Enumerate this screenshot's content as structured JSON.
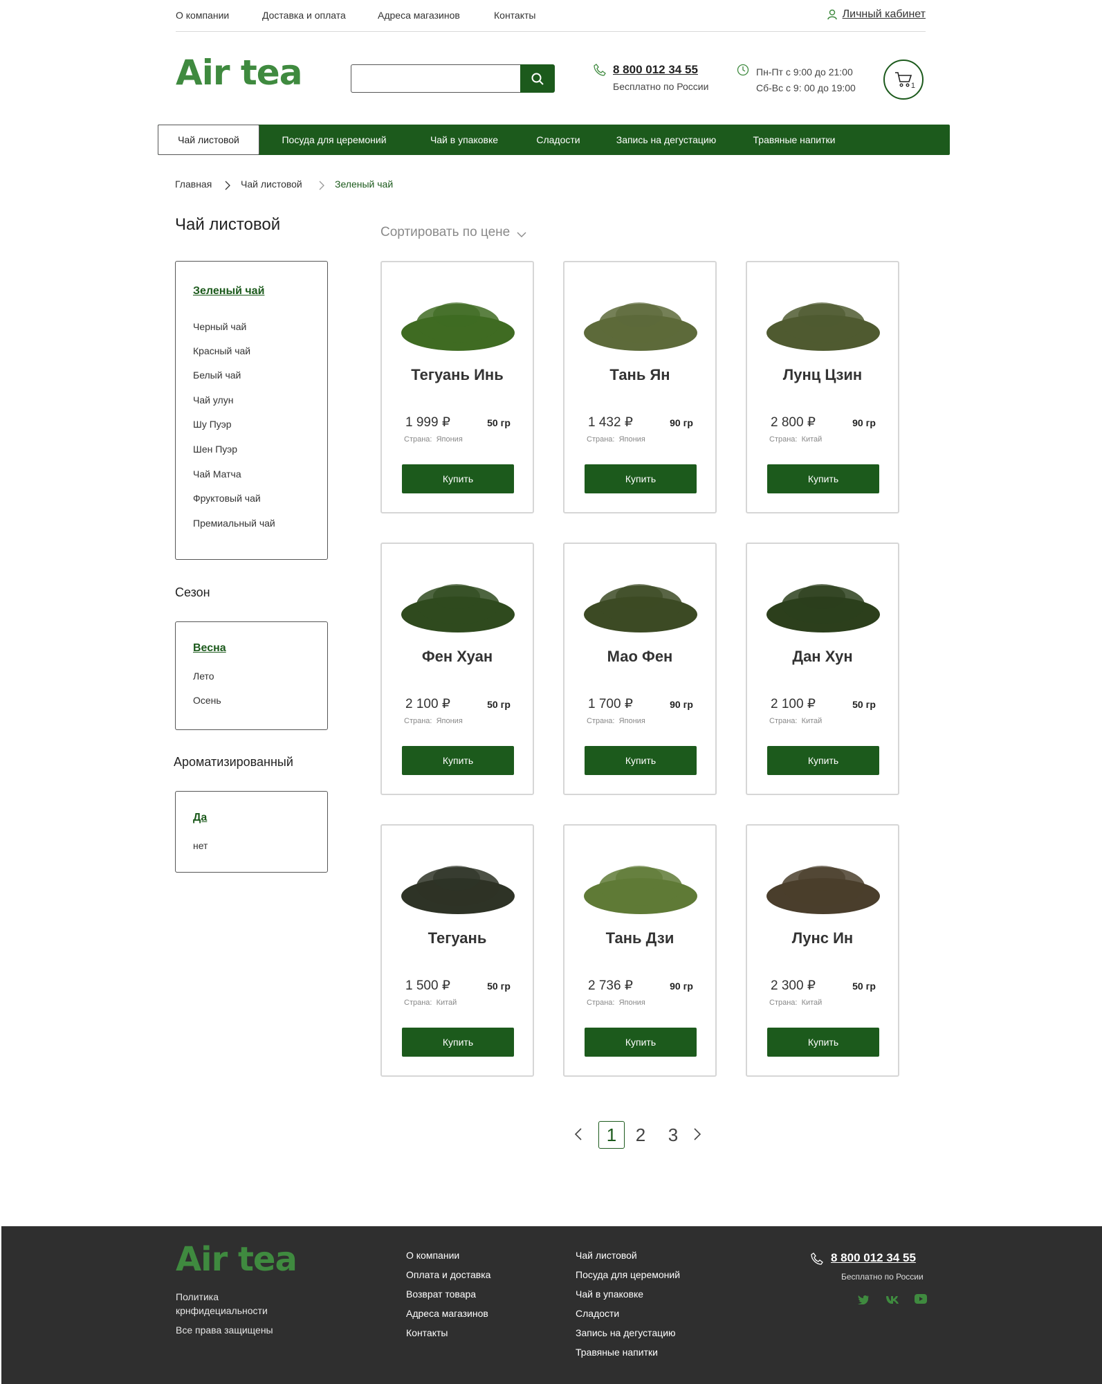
{
  "topbar": {
    "links": [
      "О компании",
      "Доставка и оплата",
      "Адреса магазинов",
      "Контакты"
    ],
    "cabinet": "Личный кабинет"
  },
  "header": {
    "logo": "Air tea",
    "search_placeholder": "",
    "phone": "8 800 012 34 55",
    "phone_note": "Бесплатно по России",
    "hours_weekday": "Пн-Пт с 9:00 до 21:00",
    "hours_weekend": "Сб-Вс с 9: 00 до 19:00",
    "cart_count": "1"
  },
  "nav": {
    "items": [
      "Чай листовой",
      "Посуда для церемоний",
      "Чай в упаковке",
      "Сладости",
      "Запись на дегустацию",
      "Травяные напитки"
    ]
  },
  "breadcrumb": [
    "Главная",
    "Чай листовой",
    "Зеленый чай"
  ],
  "sidebar": {
    "title": "Чай листовой",
    "categories": [
      "Зеленый чай",
      "Черный чай",
      "Красный чай",
      "Белый чай",
      "Чай улун",
      "Шу Пуэр",
      "Шен Пуэр",
      "Чай Матча",
      "Фруктовый чай",
      "Премиальный чай"
    ],
    "season_title": "Сезон",
    "seasons": [
      "Весна",
      "Лето",
      "Осень"
    ],
    "flavored_title": "Ароматизированный",
    "flavored": [
      "Да",
      "нет"
    ]
  },
  "sort_label": "Сортировать по цене",
  "country_label": "Страна:",
  "buy_label": "Купить",
  "products": [
    {
      "name": "Тегуань Инь",
      "price": "1 999 ₽",
      "weight": "50 гр",
      "country": "Япония",
      "color": "#3f6b22"
    },
    {
      "name": "Тань Ян",
      "price": "1 432 ₽",
      "weight": "90 гр",
      "country": "Япония",
      "color": "#5d6a3a"
    },
    {
      "name": "Лунц Цзин",
      "price": "2 800 ₽",
      "weight": "90 гр",
      "country": "Китай",
      "color": "#4f5a30"
    },
    {
      "name": "Фен Хуан",
      "price": "2 100 ₽",
      "weight": "50 гр",
      "country": "Япония",
      "color": "#2f4a1e"
    },
    {
      "name": "Мао Фен",
      "price": "1 700 ₽",
      "weight": "90 гр",
      "country": "Япония",
      "color": "#3c4a24"
    },
    {
      "name": "Дан Хун",
      "price": "2 100 ₽",
      "weight": "50 гр",
      "country": "Китай",
      "color": "#2c3f1c"
    },
    {
      "name": "Тегуань",
      "price": "1 500 ₽",
      "weight": "50 гр",
      "country": "Китай",
      "color": "#2e3326"
    },
    {
      "name": "Тань Дзи",
      "price": "2 736 ₽",
      "weight": "90 гр",
      "country": "Япония",
      "color": "#5f7a36"
    },
    {
      "name": "Лунс Ин",
      "price": "2 300 ₽",
      "weight": "50 гр",
      "country": "Китай",
      "color": "#4a3e2c"
    }
  ],
  "pagination": {
    "pages": [
      "1",
      "2",
      "3"
    ],
    "current": "1"
  },
  "footer": {
    "logo": "Air tea",
    "policy": [
      "Политика",
      "крнфидециальности"
    ],
    "rights": "Все права защищены",
    "col1": [
      "О компании",
      "Оплата и доставка",
      "Возврат товара",
      "Адреса магазинов",
      "Контакты"
    ],
    "col2": [
      "Чай листовой",
      "Посуда для церемоний",
      "Чай в упаковке",
      "Сладости",
      "Запись на дегустацию",
      "Травяные напитки"
    ],
    "phone": "8 800 012 34 55",
    "phone_note": "Бесплатно по России"
  },
  "colors": {
    "brand_green": "#1c5a1c",
    "logo_green": "#3f8a3f",
    "footer_bg": "#2f2f2f"
  }
}
